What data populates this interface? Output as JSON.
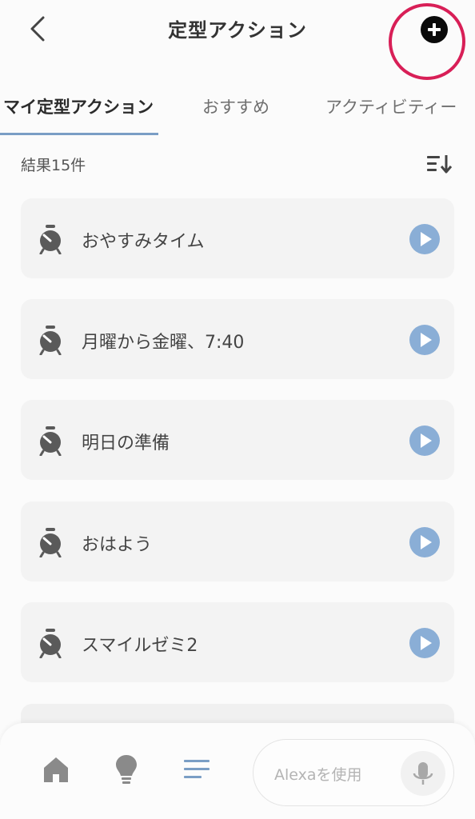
{
  "header": {
    "title": "定型アクション"
  },
  "tabs": [
    {
      "label": "マイ定型アクション",
      "active": true
    },
    {
      "label": "おすすめ",
      "active": false
    },
    {
      "label": "アクティビティー",
      "active": false
    }
  ],
  "results": {
    "count_label": "結果15件"
  },
  "routines": [
    {
      "name": "おやすみタイム",
      "icon": "alarm-clock-icon"
    },
    {
      "name": "月曜から金曜、7:40",
      "icon": "alarm-clock-icon"
    },
    {
      "name": "明日の準備",
      "icon": "alarm-clock-icon"
    },
    {
      "name": "おはよう",
      "icon": "alarm-clock-icon"
    },
    {
      "name": "スマイルゼミ2",
      "icon": "alarm-clock-icon"
    }
  ],
  "bottom_nav": {
    "items": [
      "home-icon",
      "lightbulb-icon",
      "routines-icon"
    ],
    "alexa_placeholder": "Alexaを使用"
  },
  "colors": {
    "accent": "#7a9ec5",
    "play_button": "#8aaed6",
    "highlight_ring": "#d81f57",
    "icon_gray": "#5a5a5a"
  }
}
